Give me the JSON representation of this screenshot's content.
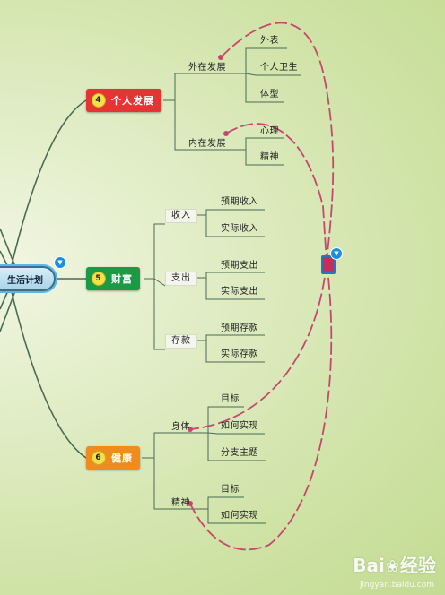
{
  "root": {
    "label": "生活计划"
  },
  "branches": [
    {
      "id": "personal",
      "number": "4",
      "label": "个人发展",
      "color": "#e53433",
      "children": [
        {
          "label": "外在发展",
          "children": [
            "外表",
            "个人卫生",
            "体型"
          ]
        },
        {
          "label": "内在发展",
          "children": [
            "心理",
            "精神"
          ]
        }
      ]
    },
    {
      "id": "wealth",
      "number": "5",
      "label": "财富",
      "color": "#1a9a44",
      "children": [
        {
          "label": "收入",
          "children": [
            "预期收入",
            "实际收入"
          ]
        },
        {
          "label": "支出",
          "children": [
            "预期支出",
            "实际支出"
          ]
        },
        {
          "label": "存款",
          "children": [
            "预期存款",
            "实际存款"
          ]
        }
      ]
    },
    {
      "id": "health",
      "number": "6",
      "label": "健康",
      "color": "#f08c1e",
      "children": [
        {
          "label": "身体",
          "children": [
            "目标",
            "如何实现",
            "分支主题"
          ]
        },
        {
          "label": "精神",
          "children": [
            "目标",
            "如何实现"
          ]
        }
      ]
    }
  ],
  "colors": {
    "relationship": "#c8466e",
    "line": "#4a6a55",
    "toggle": "#1a8fe0"
  },
  "watermark": {
    "brand": "Baidu经验",
    "url": "jingyan.baidu.com"
  }
}
